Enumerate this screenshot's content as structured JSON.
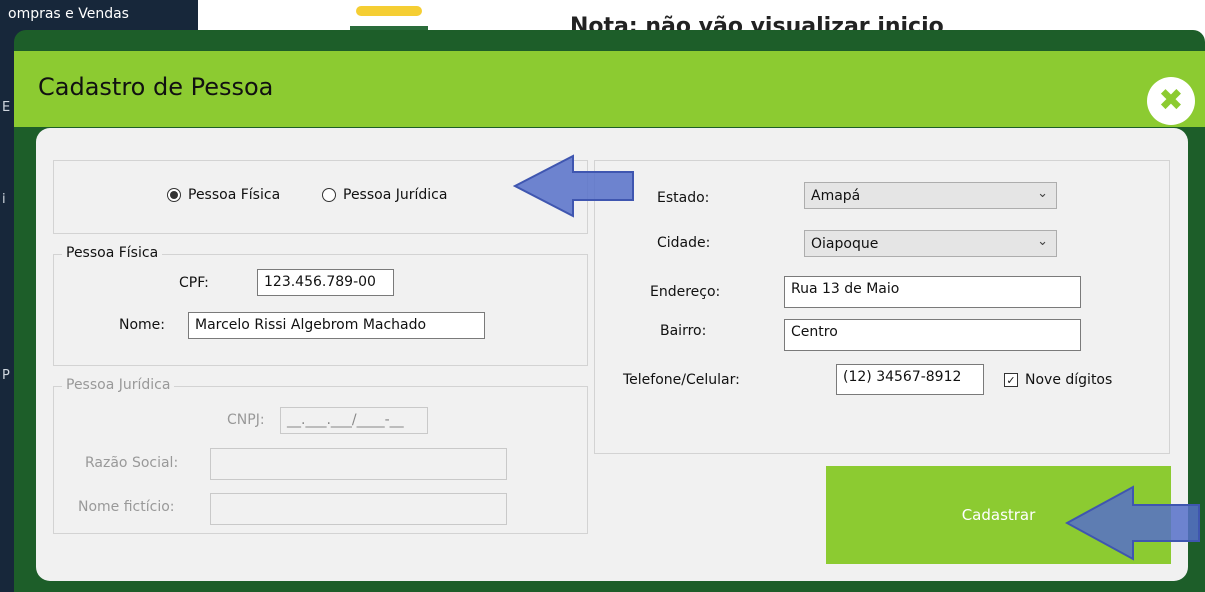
{
  "background": {
    "sidebar_menu": "ompras e Vendas",
    "banner_text": "Nota: não vão visualizar inicio"
  },
  "dialog": {
    "title": "Cadastro de Pessoa",
    "close_icon": "close-icon",
    "accent_color": "#8ccb31",
    "frame_color": "#1d5e29"
  },
  "person_type": {
    "option_fisica": "Pessoa Física",
    "option_juridica": "Pessoa Jurídica",
    "selected": "Pessoa Física"
  },
  "pessoa_fisica": {
    "legend": "Pessoa Física",
    "cpf_label": "CPF:",
    "cpf_value": "123.456.789-00",
    "nome_label": "Nome:",
    "nome_value": "Marcelo Rissi Algebrom Machado"
  },
  "pessoa_juridica": {
    "legend": "Pessoa Jurídica",
    "cnpj_label": "CNPJ:",
    "cnpj_value": "__.___.___/____-__",
    "razao_label": "Razão Social:",
    "razao_value": "",
    "fantasia_label": "Nome fictício:",
    "fantasia_value": ""
  },
  "address": {
    "estado_label": "Estado:",
    "estado_value": "Amapá",
    "cidade_label": "Cidade:",
    "cidade_value": "Oiapoque",
    "endereco_label": "Endereço:",
    "endereco_value": "Rua 13 de Maio",
    "bairro_label": "Bairro:",
    "bairro_value": "Centro",
    "telefone_label": "Telefone/Celular:",
    "telefone_value": "(12) 34567-8912",
    "nove_digitos_label": "Nove dígitos",
    "nove_digitos_checked": true
  },
  "actions": {
    "submit_label": "Cadastrar"
  }
}
